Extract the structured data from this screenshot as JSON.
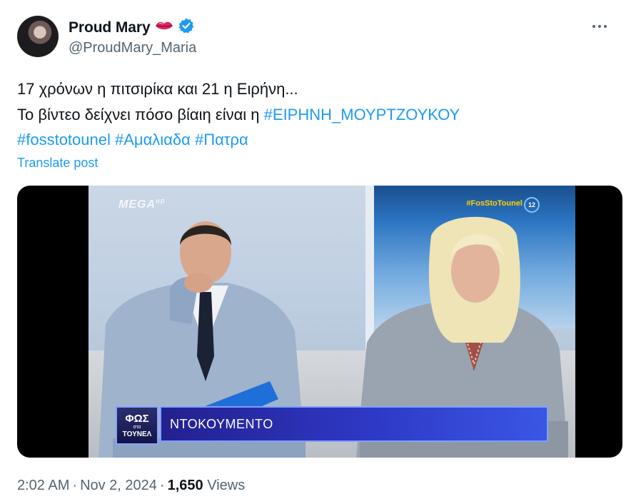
{
  "author": {
    "display_name": "Proud Mary",
    "handle": "@ProudMary_Maria",
    "emoji_icon": "lips-icon",
    "verified_icon": "verified-badge-icon"
  },
  "tweet": {
    "text_line1": "17 χρόνων η πιτσιρίκα και 21 η Ειρήνη...",
    "text_line2_prefix": "Το βίντεο δείχνει πόσο βίαιη είναι η ",
    "hashtags": [
      "#ΕΙΡΗΝΗ_ΜΟΥΡΤΖΟΥΚΟΥ",
      "#fosstotounel",
      "#Αμαλιαδα",
      "#Πατρα"
    ],
    "translate_label": "Translate post"
  },
  "media": {
    "channel_logo": "MEGA",
    "channel_logo_sub": "HD",
    "show_hashtag": "#FosStoTounel",
    "channel_number": "12",
    "program_logo_line1": "ΦΩΣ",
    "program_logo_line2": "στο",
    "program_logo_line3": "ΤΟΥΝΕΛ",
    "caption": "ΝΤΟΚΟΥΜΕΝΤΟ"
  },
  "meta": {
    "time": "2:02 AM",
    "date": "Nov 2, 2024",
    "views_count": "1,650",
    "views_label": "Views"
  },
  "colors": {
    "link": "#1d9bf0",
    "verified": "#1d9bf0",
    "text": "#0f1419",
    "secondary": "#536471"
  }
}
